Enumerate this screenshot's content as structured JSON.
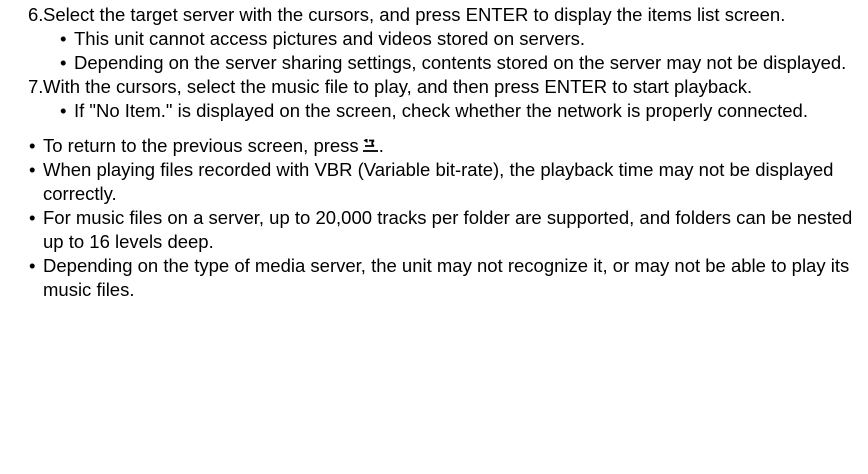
{
  "steps": [
    {
      "number": "6.",
      "text": "Select the target server with the cursors, and press ENTER to display the items list screen.",
      "subitems": [
        "This unit cannot access pictures and videos stored on servers.",
        "Depending on the server sharing settings, contents stored on the server may not be displayed."
      ]
    },
    {
      "number": "7.",
      "text": "With the cursors, select the music file to play, and then press ENTER to start playback.",
      "subitems": [
        "If \"No Item.\" is displayed on the screen, check whether the network is properly connected."
      ]
    }
  ],
  "notes": {
    "return": {
      "text": "To return to the previous screen, press",
      "icon": "return-arrow-icon",
      "end": "."
    },
    "items": [
      "When playing files recorded with VBR (Variable bit-rate), the playback time may not be displayed correctly.",
      "For music files on a server, up to 20,000 tracks per folder are supported, and folders can be nested up to 16 levels deep.",
      "Depending on the type of media server, the unit may not recognize it, or may not be able to play its music files."
    ]
  },
  "bullet_char": "•"
}
